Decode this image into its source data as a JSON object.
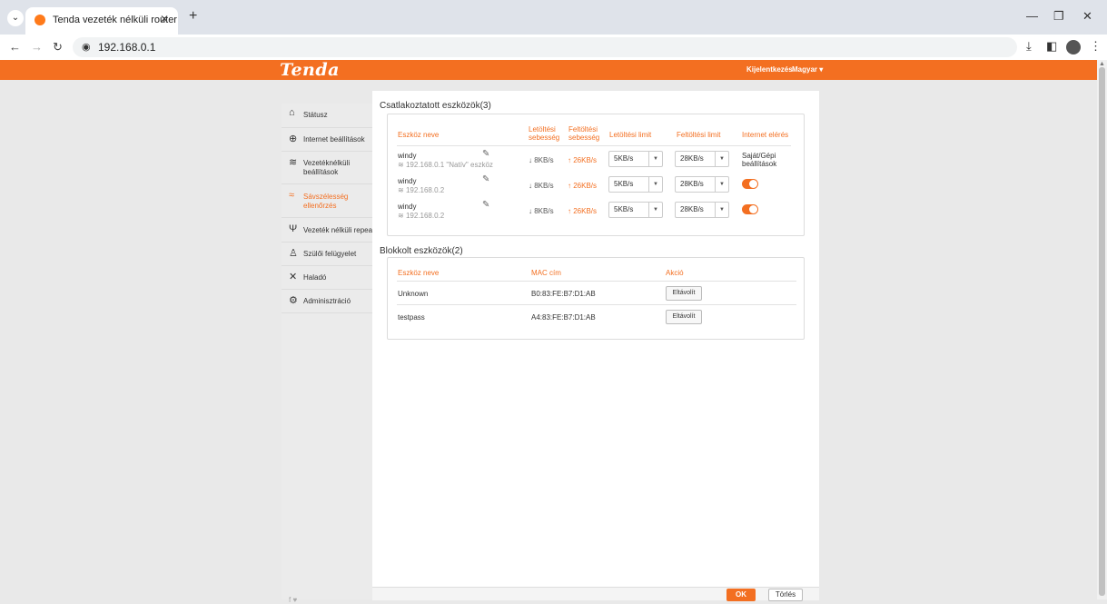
{
  "browser": {
    "tab_title": "Tenda vezeték nélküli router",
    "url": "192.168.0.1"
  },
  "header": {
    "logo": "Tenda",
    "logout": "Kijelentkezés",
    "language": "Magyar"
  },
  "sidebar": {
    "items": [
      {
        "label": "Státusz",
        "icon": "router-icon"
      },
      {
        "label": "Internet beállítások",
        "icon": "globe-icon"
      },
      {
        "label": "Vezetéknélküli beállítások",
        "icon": "wifi-icon"
      },
      {
        "label": "Sávszélesség ellenőrzés",
        "icon": "bandwidth-icon"
      },
      {
        "label": "Vezeték nélküli repeater",
        "icon": "antenna-icon"
      },
      {
        "label": "Szülői felügyelet",
        "icon": "parent-icon"
      },
      {
        "label": "Haladó",
        "icon": "tools-icon"
      },
      {
        "label": "Adminisztráció",
        "icon": "gears-icon"
      }
    ]
  },
  "connected": {
    "title": "Csatlakoztatott eszközök(3)",
    "headers": {
      "device": "Eszköz neve",
      "dl_speed": "Letöltési sebesség",
      "ul_speed": "Feltöltési sebesség",
      "dl_limit": "Letöltési limit",
      "ul_limit": "Feltöltési limit",
      "internet": "Internet elérés"
    },
    "rows": [
      {
        "name": "windy",
        "ip": "192.168.0.1 \"Natív\" eszköz",
        "dl": "↓ 8KB/s",
        "ul": "↑ 26KB/s",
        "dl_limit": "5KB/s",
        "ul_limit": "28KB/s",
        "access": "Saját/Gépi beállítások"
      },
      {
        "name": "windy",
        "ip": "192.168.0.2",
        "dl": "↓ 8KB/s",
        "ul": "↑ 26KB/s",
        "dl_limit": "5KB/s",
        "ul_limit": "28KB/s",
        "access": ""
      },
      {
        "name": "windy",
        "ip": "192.168.0.2",
        "dl": "↓ 8KB/s",
        "ul": "↑ 26KB/s",
        "dl_limit": "5KB/s",
        "ul_limit": "28KB/s",
        "access": ""
      }
    ]
  },
  "blocked": {
    "title": "Blokkolt eszközök(2)",
    "headers": {
      "device": "Eszköz neve",
      "mac": "MAC cím",
      "action": "Akció"
    },
    "rows": [
      {
        "name": "Unknown",
        "mac": "B0:83:FE:B7:D1:AB",
        "button": "Eltávolít"
      },
      {
        "name": "testpass",
        "mac": "A4:83:FE:B7:D1:AB",
        "button": "Eltávolít"
      }
    ]
  },
  "footer": {
    "ok": "OK",
    "cancel": "Törlés",
    "social": "f ♥"
  },
  "colors": {
    "accent": "#f36f21"
  }
}
